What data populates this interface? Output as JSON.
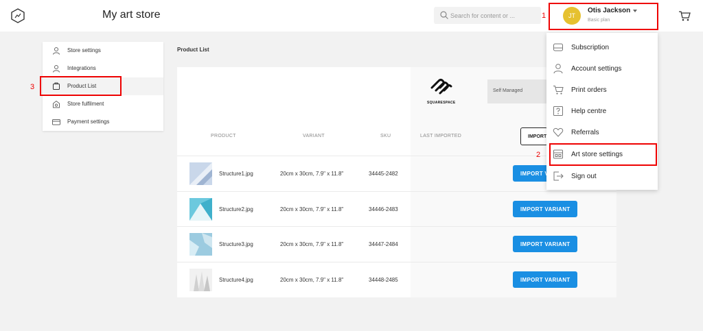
{
  "app": {
    "title": "My art store"
  },
  "search": {
    "placeholder": "Search for content or ..."
  },
  "user": {
    "name": "Otis Jackson",
    "plan": "Basic plan",
    "initials": "JT"
  },
  "annotations": [
    "1",
    "2",
    "3"
  ],
  "sidebar": {
    "items": [
      {
        "label": "Store settings",
        "icon": "user-icon"
      },
      {
        "label": "Integrations",
        "icon": "user-icon"
      },
      {
        "label": "Product List",
        "icon": "product-list-icon",
        "active": true
      },
      {
        "label": "Store fulfilment",
        "icon": "store-icon"
      },
      {
        "label": "Payment settings",
        "icon": "credit-card-icon"
      }
    ]
  },
  "main": {
    "section_title": "Product List",
    "integration": {
      "logo_text": "SQUARESPACE",
      "mode": "Self Managed",
      "import_button": "IMPORT"
    },
    "columns": [
      "PRODUCT",
      "VARIANT",
      "SKU",
      "LAST IMPORTED"
    ],
    "rows": [
      {
        "product": "Structure1.jpg",
        "variant": "20cm x 30cm, 7.9\" x 11.8\"",
        "sku": "34445-2482",
        "button": "IMPORT VARIANT"
      },
      {
        "product": "Structure2.jpg",
        "variant": "20cm x 30cm, 7.9\" x 11.8\"",
        "sku": "34446-2483",
        "button": "IMPORT VARIANT"
      },
      {
        "product": "Structure3.jpg",
        "variant": "20cm x 30cm, 7.9\" x 11.8\"",
        "sku": "34447-2484",
        "button": "IMPORT VARIANT"
      },
      {
        "product": "Structure4.jpg",
        "variant": "20cm x 30cm, 7.9\" x 11.8\"",
        "sku": "34448-2485",
        "button": "IMPORT VARIANT"
      }
    ]
  },
  "menu": {
    "items": [
      {
        "label": "Subscription",
        "icon": "subscription-icon"
      },
      {
        "label": "Account settings",
        "icon": "user-icon"
      },
      {
        "label": "Print orders",
        "icon": "cart-icon"
      },
      {
        "label": "Help centre",
        "icon": "help-icon"
      },
      {
        "label": "Referrals",
        "icon": "heart-icon"
      },
      {
        "label": "Art store settings",
        "icon": "store-icon"
      },
      {
        "label": "Sign out",
        "icon": "sign-out-icon"
      }
    ]
  },
  "colors": {
    "accent": "#1a8fe3",
    "annotation": "#ee0000",
    "avatar": "#e6c130"
  }
}
